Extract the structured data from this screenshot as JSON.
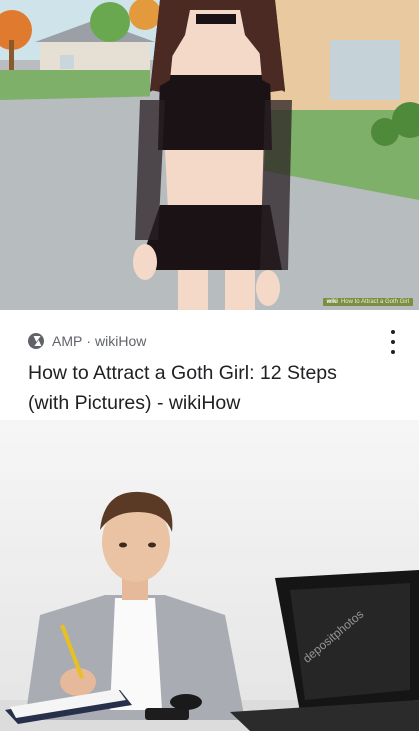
{
  "illustration": {
    "watermark_brand": "wiki",
    "watermark_text": "How to Attract a Goth Girl"
  },
  "result": {
    "amp_label": "AMP",
    "separator": "·",
    "site": "wikiHow",
    "title": "How to Attract a Goth Girl: 12 Steps (with Pictures) - wikiHow"
  },
  "photo": {
    "watermark": "depositphotos"
  },
  "colors": {
    "meta_gray": "#5f6368",
    "title_text": "#202124",
    "wikihow_green": "#7c8e44"
  },
  "icons": [
    "amp-icon",
    "more-options-icon"
  ]
}
